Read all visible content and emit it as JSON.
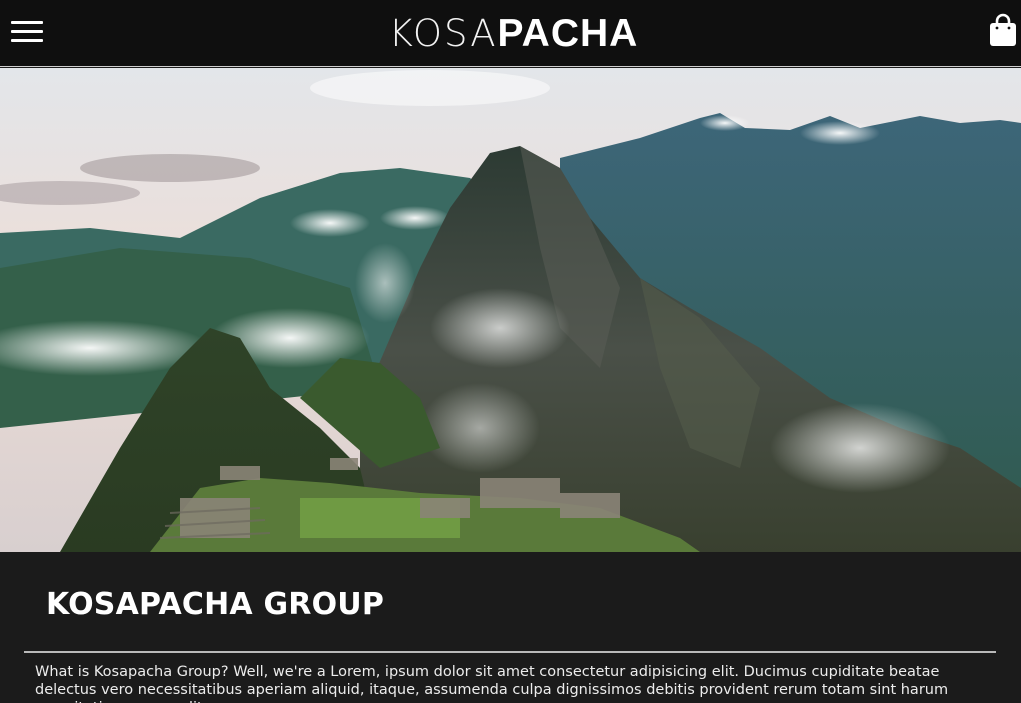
{
  "header": {
    "brand_light": "KOSA",
    "brand_bold": "PACHA",
    "menu_icon": "hamburger-menu-icon",
    "cart_icon": "shopping-bag-icon"
  },
  "hero": {
    "image_description": "photo"
  },
  "about": {
    "title": "KOSAPACHA GROUP",
    "text": "What is Kosapacha Group? Well, we're a Lorem, ipsum dolor sit amet consectetur adipisicing elit. Ducimus cupiditate beatae delectus vero necessitatibus aperiam aliquid, itaque, assumenda culpa dignissimos debitis provident rerum totam sint harum exercitationem expedita,"
  },
  "colors": {
    "header_bg": "#0f0f0f",
    "page_bg": "#1b1b1b",
    "text": "#ffffff"
  }
}
